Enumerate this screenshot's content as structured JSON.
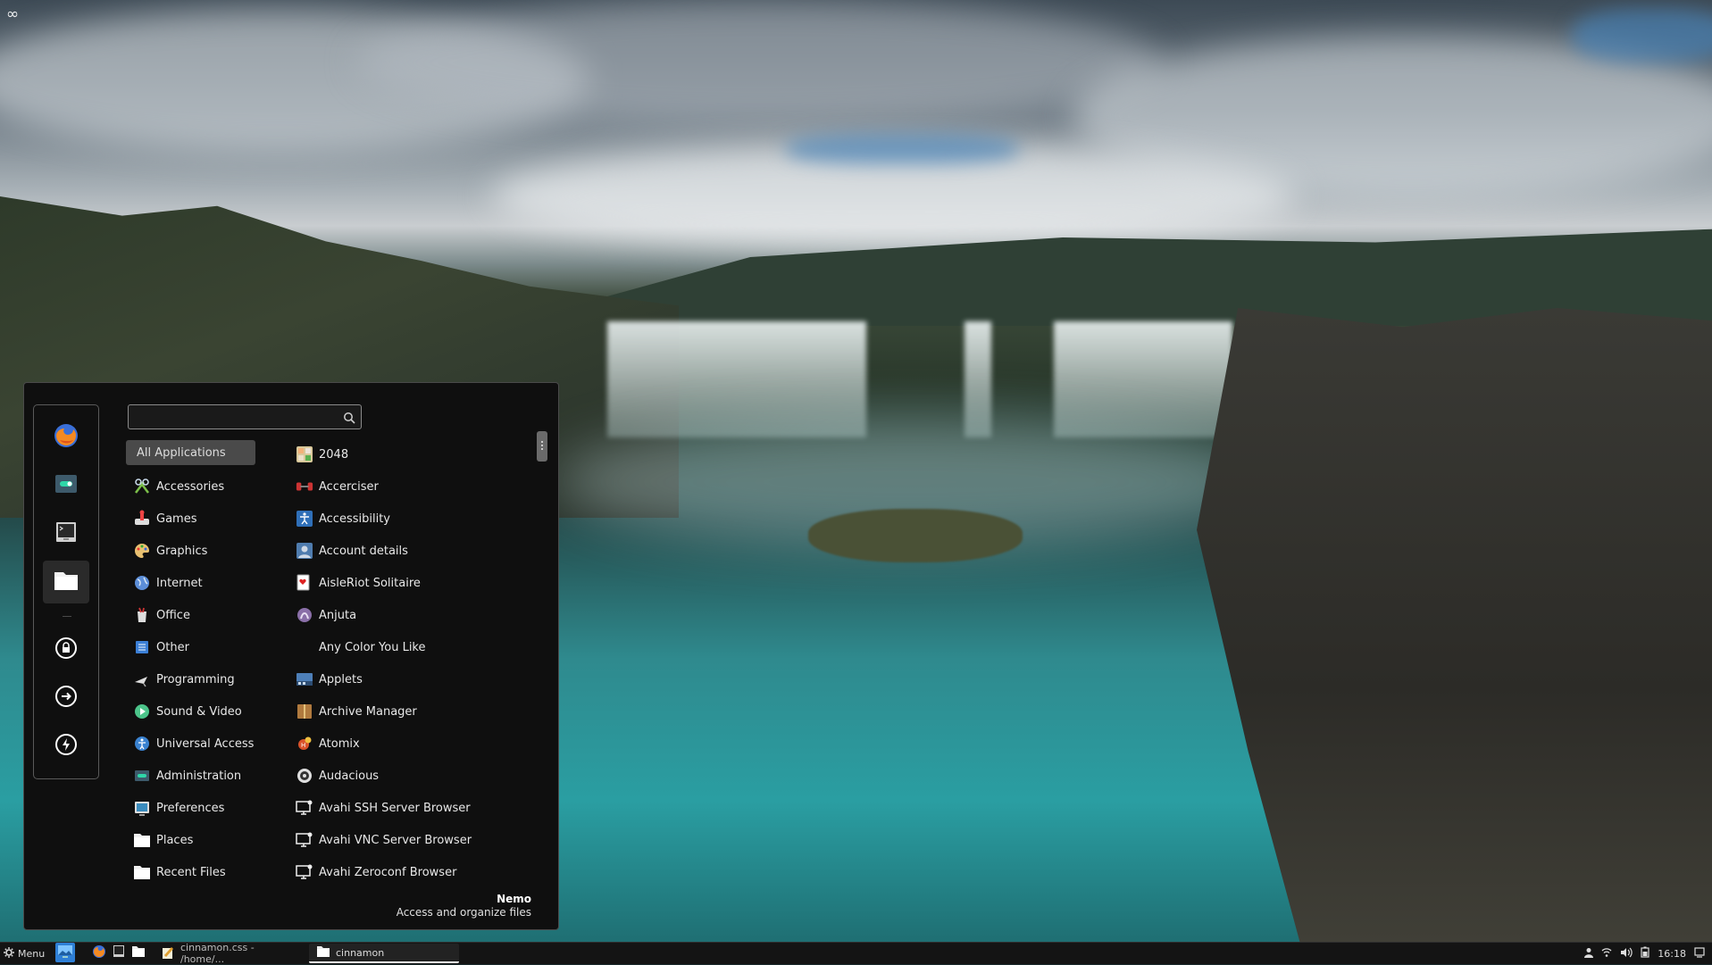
{
  "top_left_icon": "infinity-icon",
  "menu": {
    "search": {
      "value": "",
      "placeholder": "",
      "icon": "search-icon"
    },
    "favorites": [
      {
        "name": "firefox",
        "icon": "firefox-icon"
      },
      {
        "name": "settings",
        "icon": "toggle-settings-icon"
      },
      {
        "name": "terminal",
        "icon": "terminal-icon"
      },
      {
        "name": "files",
        "icon": "folder-icon",
        "active": true
      }
    ],
    "session": [
      {
        "name": "lock-screen",
        "icon": "lock-icon"
      },
      {
        "name": "logout",
        "icon": "logout-arrow-icon"
      },
      {
        "name": "shutdown",
        "icon": "power-icon"
      }
    ],
    "categories": [
      {
        "label": "All Applications",
        "icon": "",
        "selected": true
      },
      {
        "label": "Accessories",
        "icon": "accessories-icon"
      },
      {
        "label": "Games",
        "icon": "games-icon"
      },
      {
        "label": "Graphics",
        "icon": "graphics-icon"
      },
      {
        "label": "Internet",
        "icon": "globe-icon"
      },
      {
        "label": "Office",
        "icon": "office-icon"
      },
      {
        "label": "Other",
        "icon": "other-icon"
      },
      {
        "label": "Programming",
        "icon": "programming-icon"
      },
      {
        "label": "Sound & Video",
        "icon": "sound-video-icon"
      },
      {
        "label": "Universal Access",
        "icon": "universal-access-icon"
      },
      {
        "label": "Administration",
        "icon": "administration-icon"
      },
      {
        "label": "Preferences",
        "icon": "preferences-icon"
      },
      {
        "label": "Places",
        "icon": "folder-icon"
      },
      {
        "label": "Recent Files",
        "icon": "folder-icon"
      }
    ],
    "apps": [
      {
        "label": "2048",
        "icon": "2048-icon"
      },
      {
        "label": "Accerciser",
        "icon": "accerciser-icon"
      },
      {
        "label": "Accessibility",
        "icon": "accessibility-icon"
      },
      {
        "label": "Account details",
        "icon": "account-icon"
      },
      {
        "label": "AisleRiot Solitaire",
        "icon": "cards-icon"
      },
      {
        "label": "Anjuta",
        "icon": "anjuta-icon"
      },
      {
        "label": "Any Color You Like",
        "icon": ""
      },
      {
        "label": "Applets",
        "icon": "applets-icon"
      },
      {
        "label": "Archive Manager",
        "icon": "archive-icon"
      },
      {
        "label": "Atomix",
        "icon": "atomix-icon"
      },
      {
        "label": "Audacious",
        "icon": "audacious-icon"
      },
      {
        "label": "Avahi SSH Server Browser",
        "icon": "monitor-icon"
      },
      {
        "label": "Avahi VNC Server Browser",
        "icon": "monitor-icon"
      },
      {
        "label": "Avahi Zeroconf Browser",
        "icon": "monitor-icon"
      }
    ],
    "selected_app": {
      "name": "Nemo",
      "description": "Access and organize files"
    }
  },
  "taskbar": {
    "menu_label": "Menu",
    "launchers": [
      "desktop-icon",
      "firefox-icon",
      "terminal-icon",
      "folder-icon"
    ],
    "windows": [
      {
        "label": "cinnamon.css - /home/...",
        "icon": "gedit-icon",
        "active": false
      },
      {
        "label": "cinnamon",
        "icon": "folder-icon",
        "active": true
      }
    ],
    "tray": [
      "user-icon",
      "network-icon",
      "volume-icon",
      "battery-icon"
    ],
    "clock": "16:18",
    "show_desktop_icon": "show-desktop-icon"
  },
  "colors": {
    "menu_bg": "#0f0f0f",
    "selected_category_bg": "#4a4a4a",
    "taskbar_bg": "#141414",
    "accent": "#2e7fd6"
  }
}
